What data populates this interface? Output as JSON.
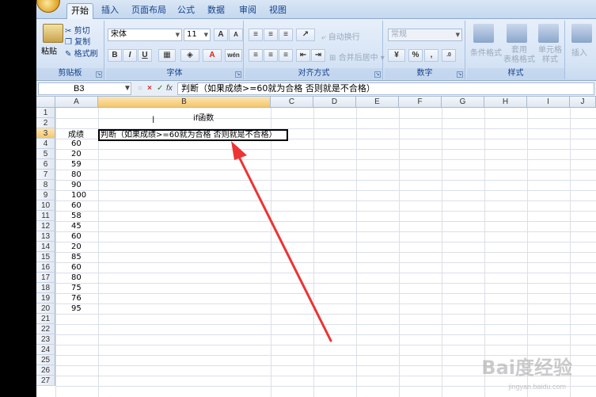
{
  "ribbon_tabs": [
    "开始",
    "插入",
    "页面布局",
    "公式",
    "数据",
    "审阅",
    "视图"
  ],
  "clipboard": {
    "paste": "粘贴",
    "cut": "剪切",
    "copy": "复制",
    "format_painter": "格式刷",
    "label": "剪贴板"
  },
  "font": {
    "name": "宋体",
    "size": "11",
    "grow": "A",
    "shrink": "A",
    "bold": "B",
    "italic": "I",
    "underline": "U",
    "phonetic": "wén",
    "label": "字体"
  },
  "alignment": {
    "wrap": "自动换行",
    "merge": "合并后居中",
    "label": "对齐方式"
  },
  "number": {
    "format": "常规",
    "percent": "%",
    "comma": ",",
    "label": "数字"
  },
  "styles": {
    "conditional": "条件格式",
    "table": "套用\n表格格式",
    "cell": "单元格\n样式",
    "label": "样式"
  },
  "cells": {
    "insert": "插入"
  },
  "formula_bar": {
    "name_box": "B3",
    "fx": "fx",
    "cancel": "×",
    "enter": "✓",
    "content": "判断（如果成绩>=60就为合格 否则就是不合格）"
  },
  "sheet": {
    "columns": [
      "A",
      "B",
      "C",
      "D",
      "E",
      "F",
      "G",
      "H",
      "I",
      "J"
    ],
    "rows": [
      "1",
      "2",
      "3",
      "4",
      "5",
      "6",
      "7",
      "8",
      "9",
      "10",
      "11",
      "12",
      "13",
      "14",
      "15",
      "16",
      "17",
      "18",
      "19",
      "20",
      "21",
      "22",
      "23",
      "24",
      "25",
      "26",
      "27"
    ],
    "selected_cell": "B3",
    "b1": "if函数",
    "b3": "判断（如果成绩>=60就为合格 否则就是不合格）",
    "a3": "成绩",
    "scores": [
      "60",
      "20",
      "59",
      "80",
      "90",
      "100",
      "60",
      "58",
      "45",
      "60",
      "20",
      "85",
      "60",
      "80",
      "75",
      "76",
      "95"
    ]
  },
  "annotation": {
    "arrow_color": "#ee3333"
  },
  "watermark": {
    "brand": "Bai度经验",
    "url": "jingyan.baidu.com"
  }
}
